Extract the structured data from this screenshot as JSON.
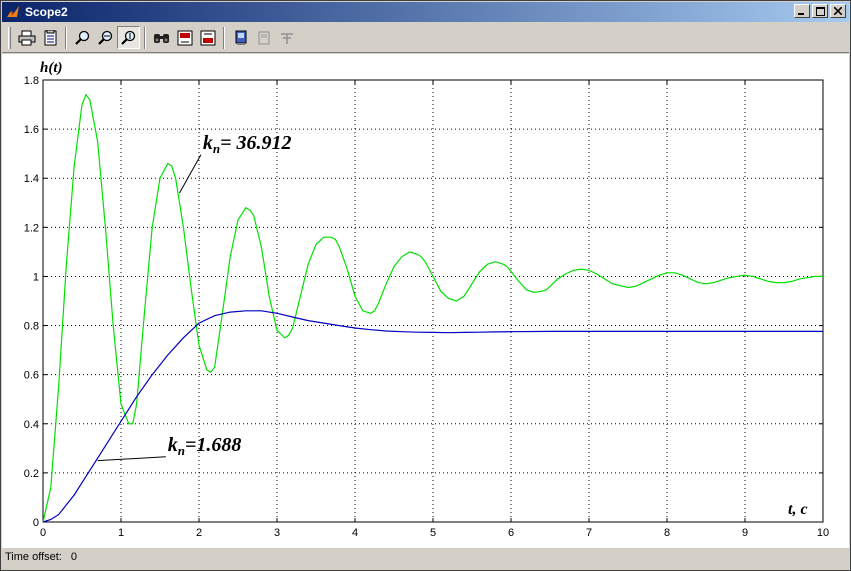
{
  "window": {
    "title": "Scope2",
    "buttons": {
      "minimize": "_",
      "maximize": "□",
      "close": "×"
    }
  },
  "toolbar": {
    "tools": [
      {
        "name": "print-icon"
      },
      {
        "name": "parameters-icon"
      },
      {
        "name": "zoom-icon"
      },
      {
        "name": "zoom-x-icon"
      },
      {
        "name": "zoom-y-icon"
      },
      {
        "name": "autoscale-icon"
      },
      {
        "name": "save-axes-icon"
      },
      {
        "name": "restore-axes-icon"
      },
      {
        "name": "floating-scope-icon"
      },
      {
        "name": "lock-axes-icon"
      },
      {
        "name": "signal-selection-icon"
      }
    ]
  },
  "status": {
    "label": "Time offset:",
    "value": "0"
  },
  "chart_data": {
    "type": "line",
    "ylabel": "h(t)",
    "xlabel": "t, c",
    "xlim": [
      0,
      10
    ],
    "ylim": [
      0,
      1.8
    ],
    "xticks": [
      "0",
      "1",
      "2",
      "3",
      "4",
      "5",
      "6",
      "7",
      "8",
      "9",
      "10"
    ],
    "yticks": [
      "0",
      "0.2",
      "0.4",
      "0.6",
      "0.8",
      "1",
      "1.2",
      "1.4",
      "1.6",
      "1.8"
    ],
    "grid": true,
    "background": "#ffffff",
    "series": [
      {
        "name": "kn = 36.912",
        "color": "#00e000",
        "x": [
          0,
          0.1,
          0.2,
          0.3,
          0.4,
          0.5,
          0.55,
          0.6,
          0.7,
          0.8,
          0.9,
          1.0,
          1.1,
          1.15,
          1.2,
          1.3,
          1.4,
          1.5,
          1.6,
          1.65,
          1.7,
          1.8,
          1.9,
          2.0,
          2.1,
          2.15,
          2.2,
          2.3,
          2.4,
          2.5,
          2.6,
          2.65,
          2.7,
          2.8,
          2.9,
          3.0,
          3.1,
          3.15,
          3.2,
          3.3,
          3.4,
          3.5,
          3.6,
          3.7,
          3.75,
          3.8,
          3.9,
          4.0,
          4.1,
          4.2,
          4.25,
          4.3,
          4.4,
          4.5,
          4.6,
          4.7,
          4.8,
          4.85,
          4.9,
          5.0,
          5.1,
          5.2,
          5.3,
          5.35,
          5.4,
          5.5,
          5.6,
          5.7,
          5.8,
          5.9,
          5.95,
          6.0,
          6.1,
          6.2,
          6.3,
          6.4,
          6.45,
          6.5,
          6.6,
          6.7,
          6.8,
          6.9,
          7.0,
          7.1,
          7.2,
          7.3,
          7.5,
          7.6,
          7.7,
          7.8,
          7.9,
          8.0,
          8.1,
          8.2,
          8.3,
          8.4,
          8.5,
          8.6,
          8.7,
          8.8,
          8.9,
          9.0,
          9.1,
          9.2,
          9.3,
          9.4,
          9.5,
          9.6,
          9.7,
          9.8,
          9.9,
          10.0
        ],
        "y": [
          0,
          0.14,
          0.55,
          1.05,
          1.45,
          1.7,
          1.74,
          1.72,
          1.55,
          1.2,
          0.8,
          0.48,
          0.4,
          0.4,
          0.48,
          0.85,
          1.2,
          1.4,
          1.46,
          1.45,
          1.4,
          1.2,
          0.95,
          0.72,
          0.62,
          0.61,
          0.63,
          0.85,
          1.08,
          1.23,
          1.28,
          1.27,
          1.25,
          1.12,
          0.92,
          0.78,
          0.75,
          0.76,
          0.79,
          0.92,
          1.05,
          1.13,
          1.16,
          1.16,
          1.15,
          1.12,
          1.03,
          0.92,
          0.86,
          0.85,
          0.86,
          0.89,
          0.97,
          1.04,
          1.08,
          1.1,
          1.09,
          1.08,
          1.06,
          1.0,
          0.94,
          0.91,
          0.9,
          0.91,
          0.92,
          0.97,
          1.02,
          1.05,
          1.06,
          1.05,
          1.04,
          1.02,
          0.98,
          0.945,
          0.935,
          0.94,
          0.945,
          0.96,
          0.99,
          1.01,
          1.025,
          1.03,
          1.025,
          1.01,
          0.99,
          0.97,
          0.955,
          0.96,
          0.975,
          0.99,
          1.005,
          1.015,
          1.015,
          1.005,
          0.99,
          0.975,
          0.97,
          0.975,
          0.985,
          0.995,
          1.0,
          1.005,
          1.0,
          0.99,
          0.98,
          0.975,
          0.975,
          0.98,
          0.99,
          0.995,
          1.0,
          1.0
        ]
      },
      {
        "name": "kn = 1.688",
        "color": "#0000c0",
        "x": [
          0,
          0.1,
          0.2,
          0.3,
          0.4,
          0.5,
          0.6,
          0.7,
          0.8,
          0.9,
          1.0,
          1.2,
          1.4,
          1.6,
          1.8,
          2.0,
          2.2,
          2.4,
          2.6,
          2.8,
          3.0,
          3.2,
          3.4,
          3.6,
          3.8,
          4.0,
          4.2,
          4.4,
          4.6,
          4.8,
          5.0,
          5.2,
          5.4,
          5.6,
          5.8,
          6.0,
          6.5,
          7.0,
          7.5,
          8.0,
          8.5,
          9.0,
          9.5,
          10.0
        ],
        "y": [
          0,
          0.01,
          0.03,
          0.07,
          0.11,
          0.16,
          0.21,
          0.26,
          0.31,
          0.36,
          0.41,
          0.51,
          0.6,
          0.68,
          0.75,
          0.81,
          0.84,
          0.855,
          0.86,
          0.86,
          0.85,
          0.835,
          0.82,
          0.81,
          0.8,
          0.79,
          0.783,
          0.778,
          0.775,
          0.773,
          0.772,
          0.771,
          0.772,
          0.773,
          0.774,
          0.775,
          0.776,
          0.776,
          0.776,
          0.776,
          0.776,
          0.776,
          0.776,
          0.776
        ]
      }
    ],
    "annotations": [
      {
        "text": "k",
        "sub": "n",
        "rest": "= 36.912",
        "x": 2.05,
        "y": 1.52,
        "arrow_to": [
          1.75,
          1.34
        ]
      },
      {
        "text": "k",
        "sub": "n",
        "rest": "=1.688",
        "x": 1.6,
        "y": 0.29,
        "arrow_to": [
          0.7,
          0.25
        ]
      }
    ]
  }
}
